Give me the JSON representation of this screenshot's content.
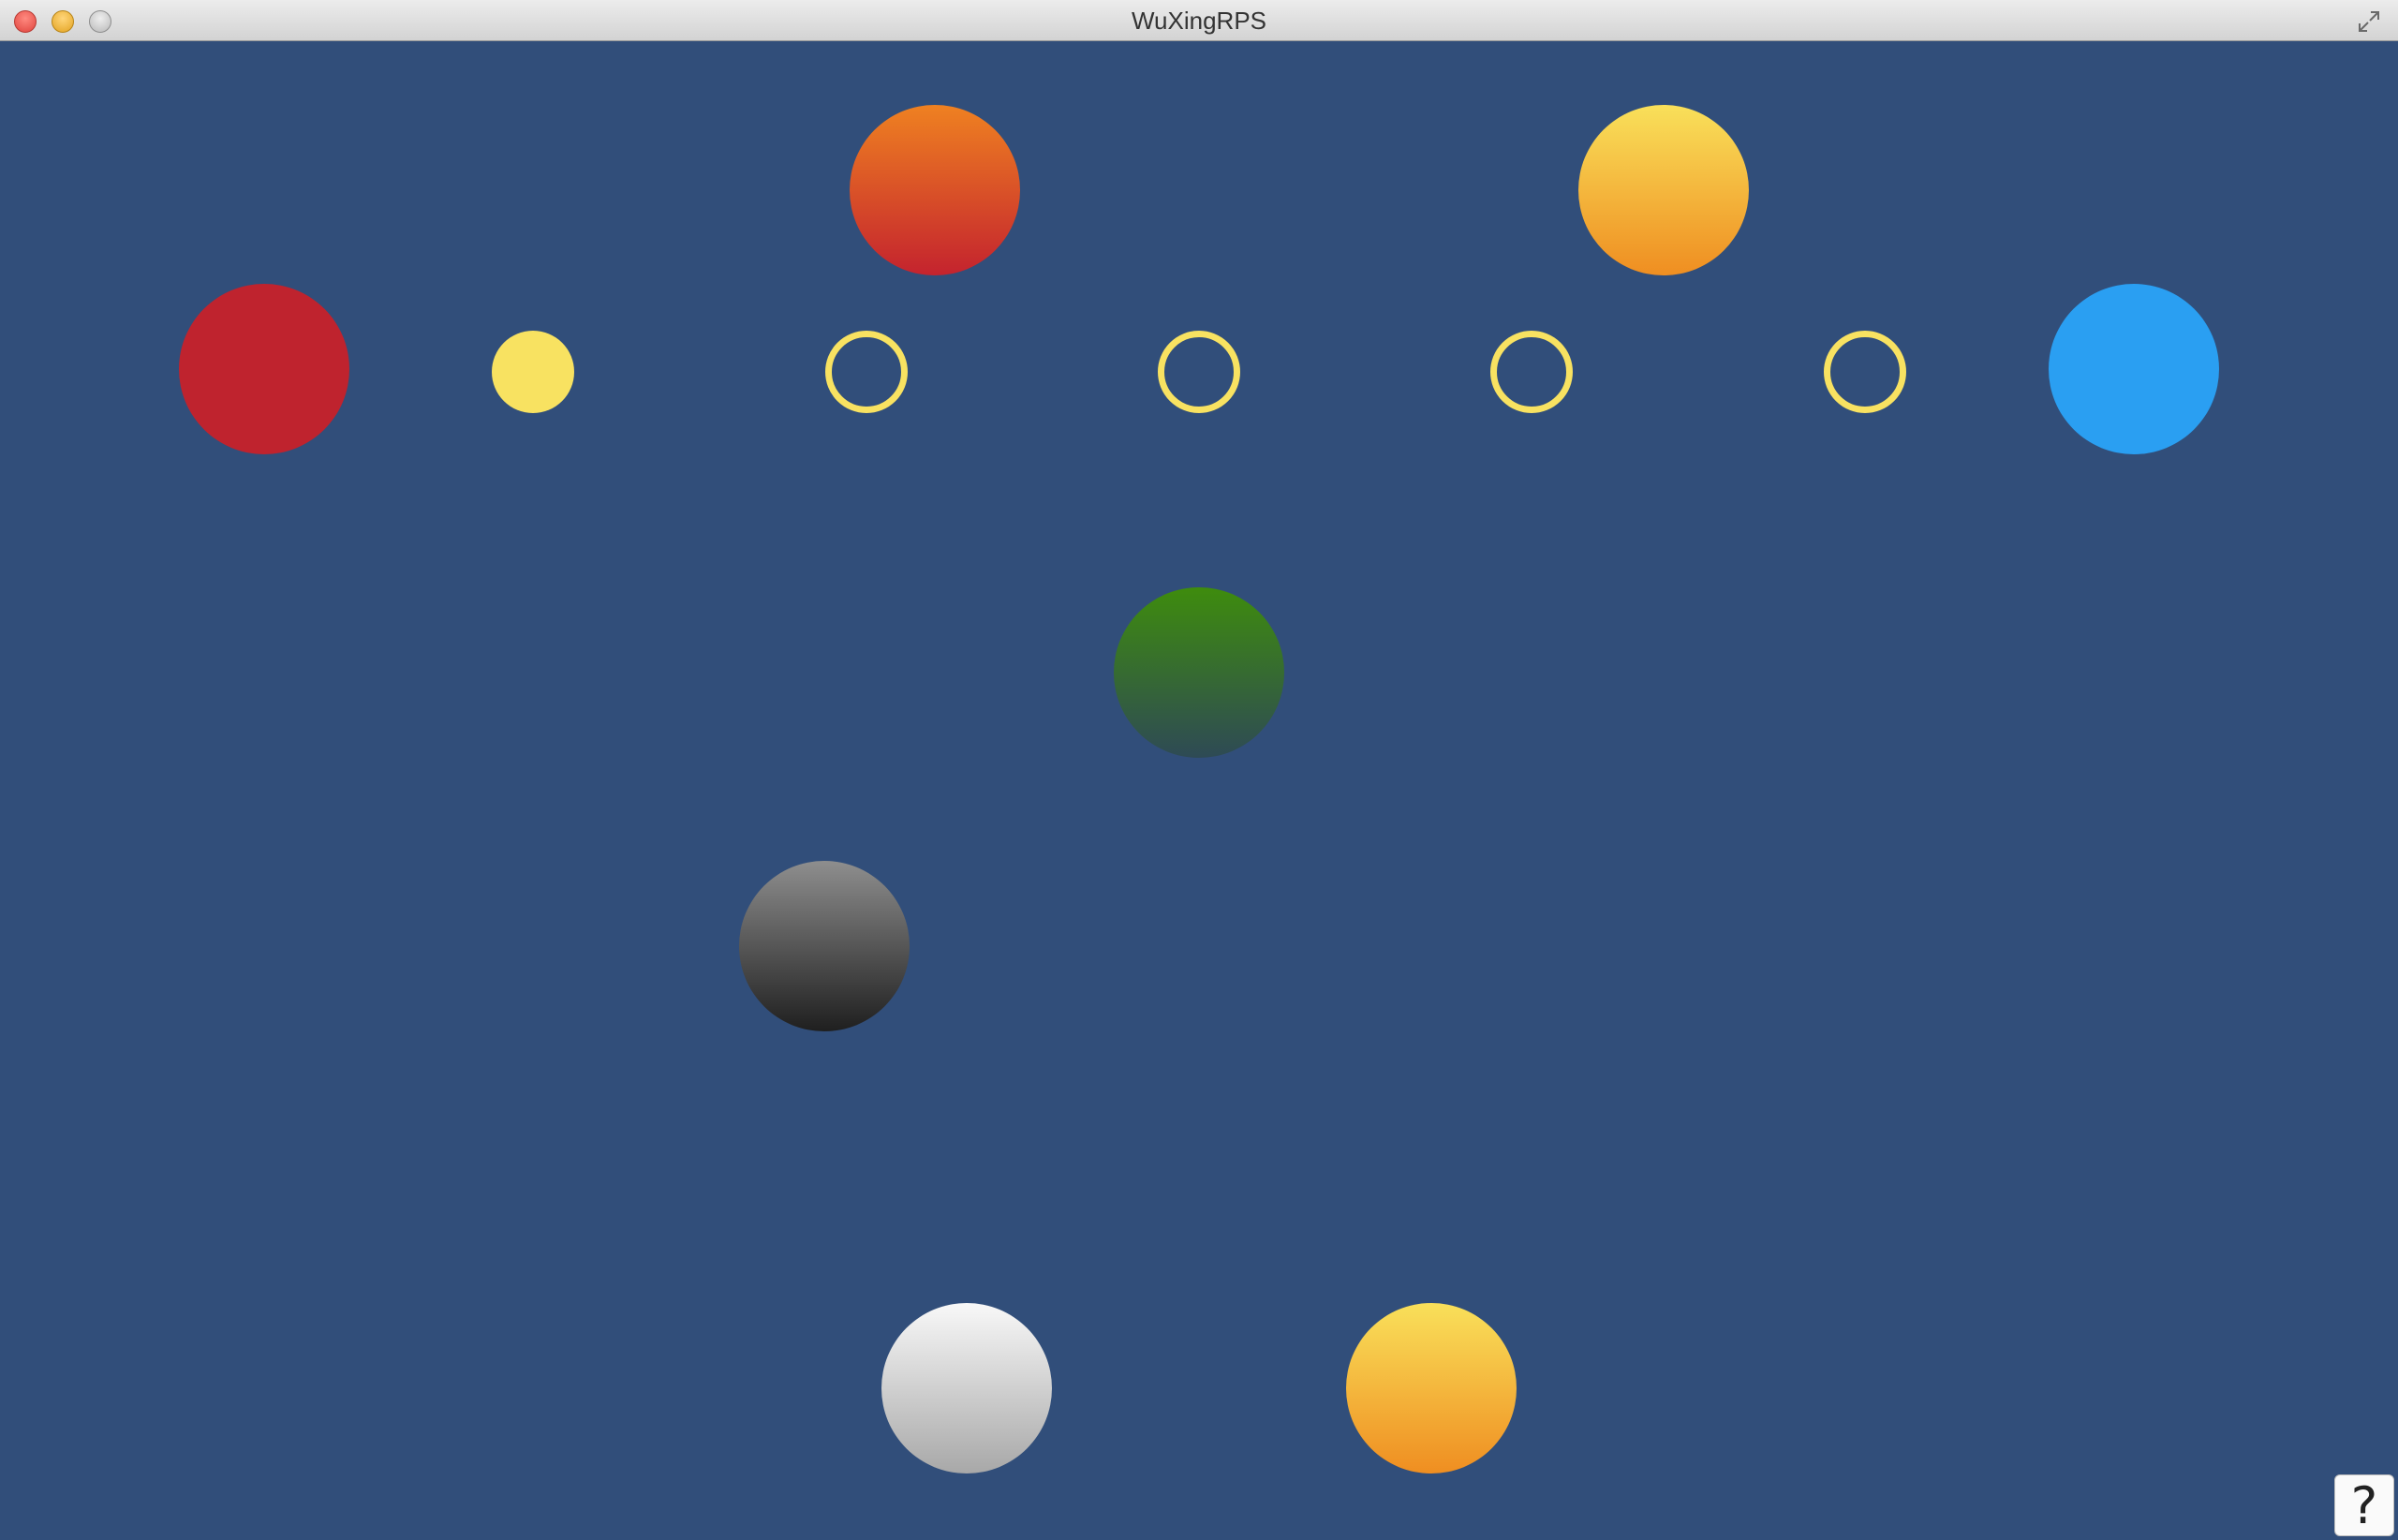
{
  "window": {
    "title": "WuXingRPS"
  },
  "board": {
    "background": "#314e7a",
    "opponent_hand": [
      {
        "element": "fire",
        "colors": [
          "#ef8121",
          "#c4232e"
        ]
      },
      {
        "element": "earth",
        "colors": [
          "#f9e05a",
          "#ef8e21"
        ]
      }
    ],
    "player_left_orb": {
      "color": "#bf232e"
    },
    "player_right_orb": {
      "color": "#2a9ff2"
    },
    "score_track": {
      "filled": 1,
      "total": 5,
      "color": "#f8e261"
    },
    "center_orb": {
      "element": "wood",
      "colors": [
        "#3e8c0d",
        "#2e4a55"
      ]
    },
    "played_orb": {
      "element": "metal",
      "colors": [
        "#8e8e8e",
        "#1f1f1f"
      ]
    },
    "player_hand": [
      {
        "element": "white",
        "colors": [
          "#f8f8f8",
          "#a8a8a8"
        ]
      },
      {
        "element": "earth",
        "colors": [
          "#f9e05a",
          "#ef8e21"
        ]
      }
    ]
  },
  "help": {
    "label": "?"
  }
}
